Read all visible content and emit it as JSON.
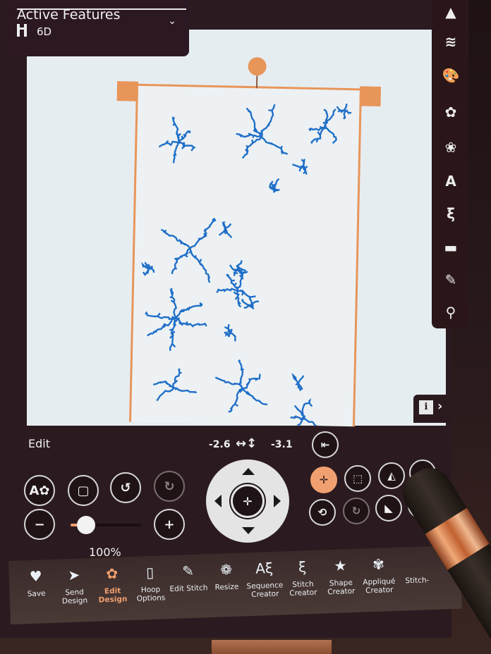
{
  "active_features": {
    "title": "Active Features",
    "hoop_label": "6D",
    "expand_icon": "chevron-down-icon"
  },
  "right_toolbar": [
    {
      "name": "3d-view",
      "icon": "pyramid-icon",
      "glyph": "▲"
    },
    {
      "name": "layers",
      "icon": "layers-icon",
      "glyph": "≋"
    },
    {
      "name": "color-palette",
      "icon": "palette-icon",
      "glyph": "🎨"
    },
    {
      "name": "design-library",
      "icon": "flower-icon",
      "glyph": "✿"
    },
    {
      "name": "online-library",
      "icon": "flower-globe-icon",
      "glyph": "❀"
    },
    {
      "name": "text",
      "icon": "letter-a-icon",
      "glyph": "A"
    },
    {
      "name": "stitches",
      "icon": "zigzag-icon",
      "glyph": "ξ"
    },
    {
      "name": "open-folder",
      "icon": "folder-icon",
      "glyph": "▬"
    },
    {
      "name": "notes",
      "icon": "edit-notes-icon",
      "glyph": "✎"
    },
    {
      "name": "search",
      "icon": "search-icon",
      "glyph": "⚲"
    }
  ],
  "info_tab": {
    "info_glyph": "i",
    "chevron": "›"
  },
  "edit_panel": {
    "title": "Edit",
    "position": {
      "x": "-2.6",
      "arrows": "↔↕",
      "y": "-3.1"
    },
    "zoom_level": "100%",
    "zoom_fraction": 0.22
  },
  "left_buttons": [
    {
      "name": "zoom-to-design",
      "glyph": "A✿"
    },
    {
      "name": "zoom-to-hoop",
      "glyph": "▢"
    },
    {
      "name": "undo",
      "glyph": "↺"
    },
    {
      "name": "redo",
      "glyph": "↻",
      "disabled": true
    },
    {
      "name": "zoom-out",
      "glyph": "−"
    },
    {
      "name": "zoom-in",
      "glyph": "+"
    }
  ],
  "dpad": {
    "center_glyph": "✛"
  },
  "right_buttons": [
    {
      "name": "park-hoop",
      "glyph": "⇤"
    },
    {
      "name": "center-design",
      "glyph": "✛",
      "active": true
    },
    {
      "name": "scale-design",
      "glyph": "⬚"
    },
    {
      "name": "mirror-horizontal",
      "glyph": "◭"
    },
    {
      "name": "mirror-vertical",
      "glyph": "◮"
    },
    {
      "name": "rotate",
      "glyph": "⟲"
    },
    {
      "name": "rotate-degrees",
      "glyph": "↻"
    },
    {
      "name": "duplicate",
      "glyph": "◣"
    },
    {
      "name": "more",
      "glyph": "○"
    }
  ],
  "bottom_bar": [
    {
      "name": "save",
      "icon": "heart-icon",
      "glyph": "♥",
      "label": "Save"
    },
    {
      "name": "send-design",
      "icon": "paper-plane-icon",
      "glyph": "➤",
      "label": "Send Design"
    },
    {
      "name": "edit-design",
      "icon": "flower-pencil-icon",
      "glyph": "✿",
      "label": "Edit Design",
      "active": true
    },
    {
      "name": "hoop-options",
      "icon": "hoop-icon",
      "glyph": "▯",
      "label": "Hoop Options"
    },
    {
      "name": "edit-stitch",
      "icon": "stitch-pencil-icon",
      "glyph": "✎",
      "label": "Edit Stitch"
    },
    {
      "name": "resize",
      "icon": "resize-flowers-icon",
      "glyph": "❁",
      "label": "Resize"
    },
    {
      "name": "sequence-creator",
      "icon": "sequence-icon",
      "glyph": "Aξ",
      "label": "Sequence Creator"
    },
    {
      "name": "stitch-creator",
      "icon": "stitch-creator-icon",
      "glyph": "ξ",
      "label": "Stitch Creator"
    },
    {
      "name": "shape-creator",
      "icon": "shape-icon",
      "glyph": "★",
      "label": "Shape Creator"
    },
    {
      "name": "applique-creator",
      "icon": "applique-icon",
      "glyph": "✾",
      "label": "Appliqué Creator"
    },
    {
      "name": "stitch-out",
      "icon": "stitch-out-icon",
      "glyph": "",
      "label": "Stitch-"
    }
  ],
  "colors": {
    "accent": "#f0a070",
    "hoop": "#e8955a",
    "stitch": "#1f6fc8",
    "panel_bg": "#2b1b20"
  }
}
